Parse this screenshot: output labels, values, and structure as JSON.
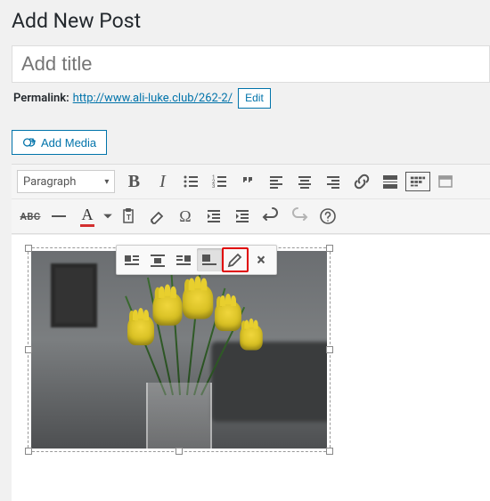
{
  "page_title": "Add New Post",
  "title_placeholder": "Add title",
  "permalink": {
    "label": "Permalink:",
    "url": "http://www.ali-luke.club/262-2/",
    "edit_label": "Edit"
  },
  "add_media_label": "Add Media",
  "format_select": "Paragraph",
  "toolbar_row1": {
    "bold": "B",
    "italic": "I"
  },
  "toolbar_row2": {
    "strike": "ABC",
    "textcolor": "A",
    "omega": "Ω"
  },
  "inline_toolbar": {
    "close": "×"
  }
}
